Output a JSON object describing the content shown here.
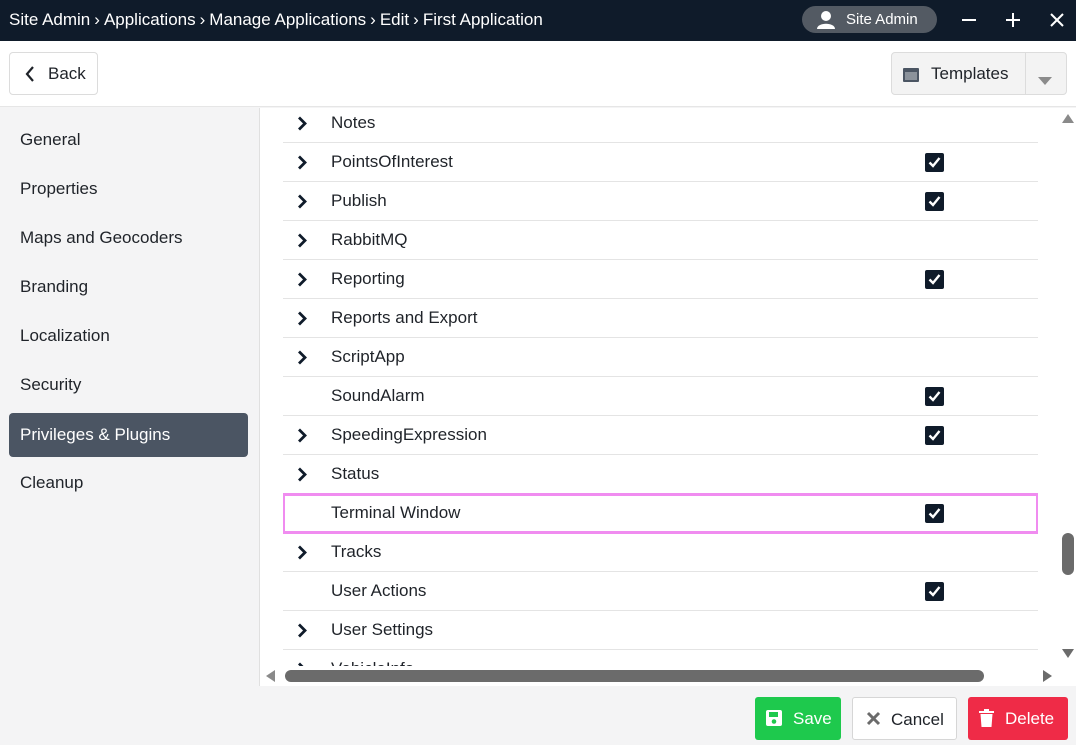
{
  "breadcrumb": [
    "Site Admin",
    "Applications",
    "Manage Applications",
    "Edit",
    "First Application"
  ],
  "user": {
    "name": "Site Admin",
    "icon": "user-icon"
  },
  "window_controls": {
    "minimize": "minimize-icon",
    "maximize": "plus-icon",
    "close": "close-icon"
  },
  "toolbar": {
    "back_label": "Back",
    "templates_label": "Templates"
  },
  "sidebar": {
    "items": [
      {
        "label": "General",
        "active": false
      },
      {
        "label": "Properties",
        "active": false
      },
      {
        "label": "Maps and Geocoders",
        "active": false
      },
      {
        "label": "Branding",
        "active": false
      },
      {
        "label": "Localization",
        "active": false
      },
      {
        "label": "Security",
        "active": false
      },
      {
        "label": "Privileges & Plugins",
        "active": true
      },
      {
        "label": "Cleanup",
        "active": false
      }
    ]
  },
  "plugins": {
    "rows": [
      {
        "label": "Notes",
        "expandable": true,
        "checked": false
      },
      {
        "label": "PointsOfInterest",
        "expandable": true,
        "checked": true
      },
      {
        "label": "Publish",
        "expandable": true,
        "checked": true
      },
      {
        "label": "RabbitMQ",
        "expandable": true,
        "checked": false
      },
      {
        "label": "Reporting",
        "expandable": true,
        "checked": true
      },
      {
        "label": "Reports and Export",
        "expandable": true,
        "checked": false
      },
      {
        "label": "ScriptApp",
        "expandable": true,
        "checked": false
      },
      {
        "label": "SoundAlarm",
        "expandable": false,
        "checked": true
      },
      {
        "label": "SpeedingExpression",
        "expandable": true,
        "checked": true
      },
      {
        "label": "Status",
        "expandable": true,
        "checked": false
      },
      {
        "label": "Terminal Window",
        "expandable": false,
        "checked": true,
        "highlighted": true
      },
      {
        "label": "Tracks",
        "expandable": true,
        "checked": false
      },
      {
        "label": "User Actions",
        "expandable": false,
        "checked": true
      },
      {
        "label": "User Settings",
        "expandable": true,
        "checked": false
      },
      {
        "label": "VehicleInfo",
        "expandable": true,
        "checked": false
      }
    ]
  },
  "footer": {
    "save_label": "Save",
    "cancel_label": "Cancel",
    "delete_label": "Delete"
  },
  "colors": {
    "titlebar": "#0f1b2a",
    "active_nav": "#4b5563",
    "save": "#1ec94d",
    "delete": "#ef2b47",
    "highlight": "#f08cf0"
  }
}
